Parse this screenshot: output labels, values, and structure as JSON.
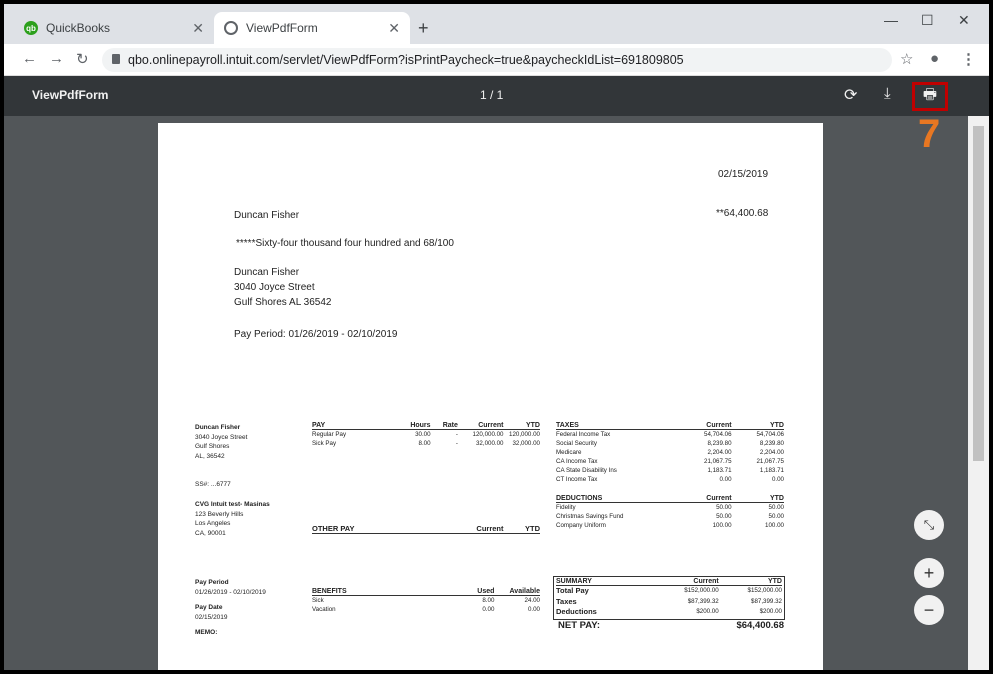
{
  "browser": {
    "tabs": [
      {
        "label": "QuickBooks"
      },
      {
        "label": "ViewPdfForm"
      }
    ],
    "url": "qbo.onlinepayroll.intuit.com/servlet/ViewPdfForm?isPrintPaycheck=true&paycheckIdList=691809805"
  },
  "pdf": {
    "title": "ViewPdfForm",
    "page_indicator": "1 / 1",
    "step_marker": "7",
    "highlight_color": "#c00000",
    "marker_color": "#e87722"
  },
  "check": {
    "date": "02/15/2019",
    "payee": "Duncan Fisher",
    "amount": "**64,400.68",
    "amount_words": "*****Sixty-four thousand four hundred and 68/100",
    "addr1": "Duncan Fisher",
    "addr2": "3040  Joyce Street",
    "addr3": "Gulf Shores AL 36542",
    "pay_period": "Pay Period:  01/26/2019 - 02/10/2019"
  },
  "stub": {
    "employee": [
      "Duncan Fisher",
      "3040  Joyce Street",
      "Gulf Shores",
      "AL, 36542"
    ],
    "ssn": "SS#: ...6777",
    "employer": [
      "CVG Intuit test- Masinas",
      "123 Beverly Hills",
      "Los Angeles",
      "CA, 90001"
    ],
    "pay_period_label": "Pay Period",
    "pay_period": "01/26/2019 - 02/10/2019",
    "pay_date_label": "Pay Date",
    "pay_date": "02/15/2019",
    "memo": "MEMO:",
    "pay": {
      "headers": [
        "PAY",
        "Hours",
        "Rate",
        "Current",
        "YTD"
      ],
      "rows": [
        [
          "Regular Pay",
          "30.00",
          "-",
          "120,000.00",
          "120,000.00"
        ],
        [
          "Sick Pay",
          "8.00",
          "-",
          "32,000.00",
          "32,000.00"
        ]
      ]
    },
    "other_pay": {
      "headers": [
        "OTHER PAY",
        "Current",
        "YTD"
      ]
    },
    "benefits": {
      "headers": [
        "BENEFITS",
        "Used",
        "Available"
      ],
      "rows": [
        [
          "Sick",
          "8.00",
          "24.00"
        ],
        [
          "Vacation",
          "0.00",
          "0.00"
        ]
      ]
    },
    "taxes": {
      "headers": [
        "TAXES",
        "Current",
        "YTD"
      ],
      "rows": [
        [
          "Federal Income Tax",
          "54,704.06",
          "54,704.06"
        ],
        [
          "Social Security",
          "8,239.80",
          "8,239.80"
        ],
        [
          "Medicare",
          "2,204.00",
          "2,204.00"
        ],
        [
          "CA Income Tax",
          "21,067.75",
          "21,067.75"
        ],
        [
          "CA State Disability Ins",
          "1,183.71",
          "1,183.71"
        ],
        [
          "CT Income Tax",
          "0.00",
          "0.00"
        ]
      ]
    },
    "deductions": {
      "headers": [
        "DEDUCTIONS",
        "Current",
        "YTD"
      ],
      "rows": [
        [
          "Fidelity",
          "50.00",
          "50.00"
        ],
        [
          "Christmas Savings Fund",
          "50.00",
          "50.00"
        ],
        [
          "Company Uniform",
          "100.00",
          "100.00"
        ]
      ]
    },
    "summary": {
      "headers": [
        "SUMMARY",
        "Current",
        "YTD"
      ],
      "rows": [
        [
          "Total Pay",
          "$152,000.00",
          "$152,000.00"
        ],
        [
          "Taxes",
          "$87,399.32",
          "$87,399.32"
        ],
        [
          "Deductions",
          "$200.00",
          "$200.00"
        ]
      ],
      "net_label": "NET PAY:",
      "net_value": "$64,400.68"
    }
  }
}
